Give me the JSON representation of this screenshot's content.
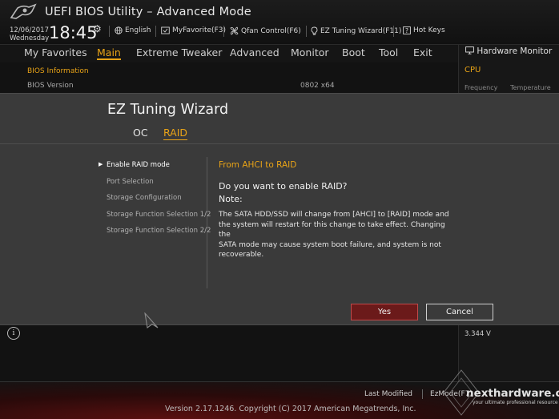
{
  "header": {
    "app_title": "UEFI BIOS Utility – Advanced Mode",
    "date": "12/06/2017",
    "day": "Wednesday",
    "time": "18:45",
    "links": [
      {
        "label": "English",
        "icon": "globe-icon"
      },
      {
        "label": "MyFavorite(F3)",
        "icon": "favorite-icon"
      },
      {
        "label": "Qfan Control(F6)",
        "icon": "fan-icon"
      },
      {
        "label": "EZ Tuning Wizard(F11)",
        "icon": "lightbulb-icon"
      },
      {
        "label": "Hot Keys",
        "icon": "help-icon"
      }
    ]
  },
  "menu": {
    "items": [
      "My Favorites",
      "Main",
      "Extreme Tweaker",
      "Advanced",
      "Monitor",
      "Boot",
      "Tool",
      "Exit"
    ],
    "active": "Main"
  },
  "hardware_monitor": {
    "title": "Hardware Monitor",
    "cpu_label": "CPU",
    "frequency_label": "Frequency",
    "temperature_label": "Temperature",
    "voltage_value": "3.344 V"
  },
  "main": {
    "bios_info_label": "BIOS Information",
    "bios_version_label": "BIOS Version",
    "bios_version_value": "0802 x64"
  },
  "wizard": {
    "title": "EZ Tuning Wizard",
    "tabs": [
      "OC",
      "RAID"
    ],
    "active_tab": "RAID",
    "steps": [
      "Enable RAID mode",
      "Port Selection",
      "Storage Configuration",
      "Storage Function Selection 1/2",
      "Storage Function Selection 2/2"
    ],
    "current_step": "Enable RAID mode",
    "heading": "From AHCI to RAID",
    "question": "Do you want to enable RAID?",
    "note_label": "Note:",
    "note_lines": [
      "The SATA HDD/SSD will change from [AHCI] to [RAID] mode and",
      "the system will restart for this change to take effect. Changing the",
      "SATA mode may cause system boot failure, and system is not",
      "recoverable."
    ],
    "yes_label": "Yes",
    "cancel_label": "Cancel"
  },
  "footer": {
    "last_modified": "Last Modified",
    "ez_mode": "EzMode(F7)",
    "copyright": "Version 2.17.1246. Copyright (C) 2017 American Megatrends, Inc.",
    "watermark_name": "nexthardware.com",
    "watermark_tagline": "your ultimate professional resource"
  },
  "colors": {
    "accent": "#e8a317",
    "yes_button": "#6b1a1a",
    "modal_bg": "#3a3a3a"
  }
}
